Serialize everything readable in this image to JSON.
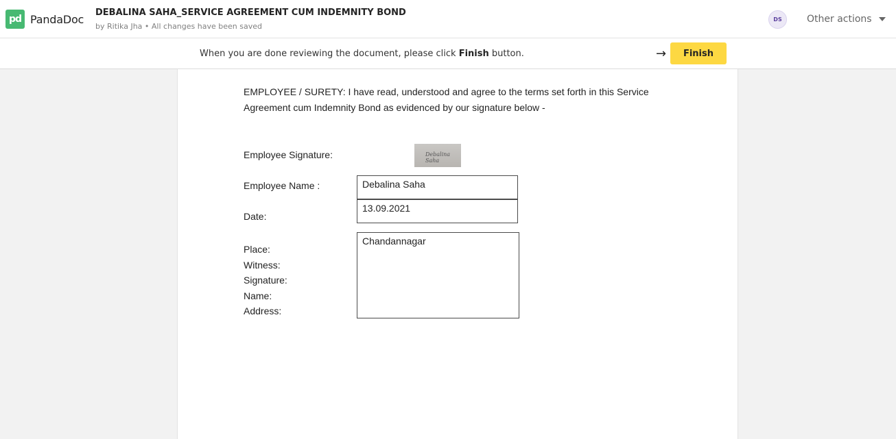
{
  "app": {
    "name": "PandaDoc",
    "logo_glyph": "pd"
  },
  "header": {
    "title": "DEBALINA SAHA_SERVICE AGREEMENT CUM INDEMNITY BOND",
    "subtitle": "by Ritika Jha • All changes have been saved",
    "avatar_initials": "DS",
    "other_actions_label": "Other actions"
  },
  "banner": {
    "message_prefix": "When you are done reviewing the document, please click ",
    "message_bold": "Finish",
    "message_suffix": " button.",
    "arrow_glyph": "→",
    "finish_label": "Finish"
  },
  "document": {
    "paragraph": "EMPLOYEE / SURETY: I have read, understood and agree to the terms set forth in this Service Agreement cum Indemnity Bond as evidenced by our signature below -",
    "employee_signature_label": "Employee Signature:",
    "signature_text": "Debalina Saha",
    "employee_name_label": "Employee Name :",
    "employee_name_value": "Debalina Saha",
    "date_label": "Date:",
    "date_value": "13.09.2021",
    "place_label": "Place:",
    "witness_label": "Witness:",
    "signature_label": "Signature:",
    "name_label": "Name:",
    "address_label": "Address:",
    "place_value": "Chandannagar"
  },
  "colors": {
    "brand_green": "#47b972",
    "finish_yellow": "#fdd842",
    "background": "#f2f2f2"
  }
}
